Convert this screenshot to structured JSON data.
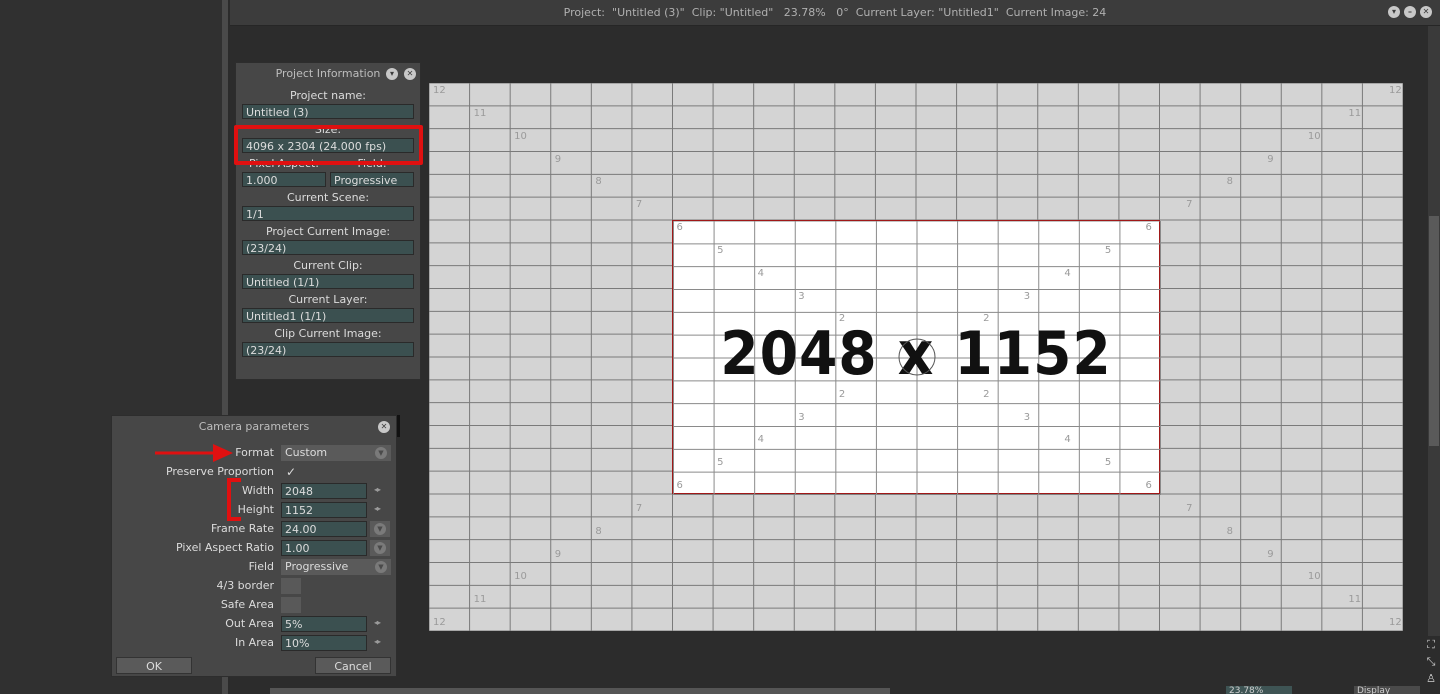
{
  "window": {
    "title": "Project:  \"Untitled (3)\"  Clip: \"Untitled\"   23.78%   0°  Current Layer: \"Untitled1\"  Current Image: 24",
    "icons": [
      "chevron-down-icon",
      "minimize-icon",
      "close-icon"
    ]
  },
  "project_info": {
    "title": "Project Information",
    "project_name_label": "Project name:",
    "project_name": "Untitled (3)",
    "size_label": "Size:",
    "size": "4096 x 2304 (24.000 fps)",
    "pixel_aspect_label": "Pixel Aspect:",
    "pixel_aspect": "1.000",
    "field_label": "Field:",
    "field": "Progressive",
    "current_scene_label": "Current Scene:",
    "current_scene": "1/1",
    "project_current_image_label": "Project Current Image:",
    "project_current_image": "(23/24)",
    "current_clip_label": "Current Clip:",
    "current_clip": "Untitled (1/1)",
    "current_layer_label": "Current Layer:",
    "current_layer": "Untitled1 (1/1)",
    "clip_current_image_label": "Clip Current Image:",
    "clip_current_image": "(23/24)"
  },
  "camera": {
    "title": "Camera parameters",
    "format_label": "Format",
    "format": "Custom",
    "preserve_label": "Preserve Proportion",
    "preserve_check": "✓",
    "width_label": "Width",
    "width": "2048",
    "height_label": "Height",
    "height": "1152",
    "frame_rate_label": "Frame Rate",
    "frame_rate": "24.00",
    "pixel_aspect_label": "Pixel Aspect Ratio",
    "pixel_aspect": "1.00",
    "field_label": "Field",
    "field": "Progressive",
    "border43_label": "4/3 border",
    "safe_area_label": "Safe Area",
    "out_area_label": "Out Area",
    "out_area": "5%",
    "in_area_label": "In Area",
    "in_area": "10%",
    "ok_label": "OK",
    "cancel_label": "Cancel",
    "stepper_glyph": "◂▸"
  },
  "canvas": {
    "frame_label": "2048 x 1152",
    "ticks": [
      "12",
      "11",
      "10",
      "9",
      "8",
      "7",
      "6",
      "5",
      "4",
      "3",
      "2"
    ]
  },
  "status": {
    "zoom": "23.78%",
    "display": "Display"
  },
  "colors": {
    "annotation": "#e01010",
    "field_bg": "#3b5050",
    "frame_border": "#a01818"
  }
}
